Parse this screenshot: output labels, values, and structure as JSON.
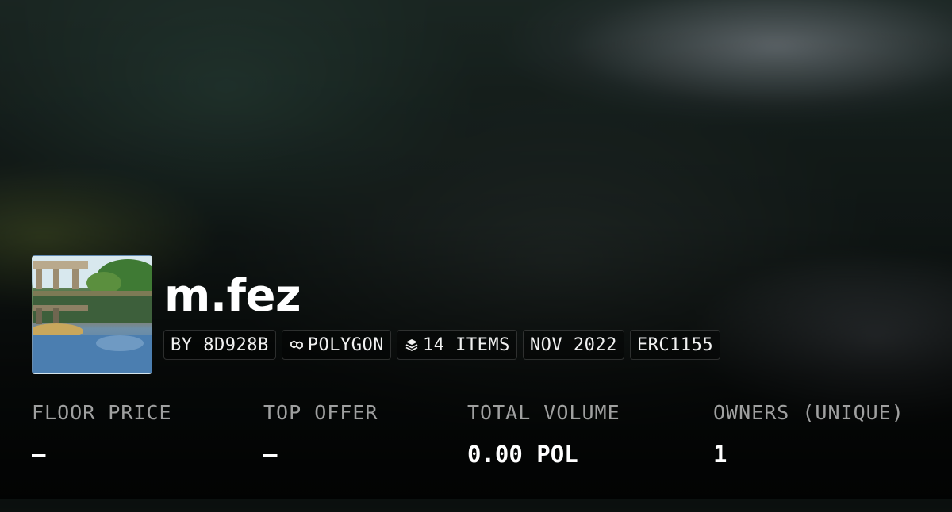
{
  "collection": {
    "title": "m.fez",
    "tags": [
      {
        "icon": "",
        "label": "BY 8D928B"
      },
      {
        "icon": "polygon-chain-icon",
        "label": "POLYGON"
      },
      {
        "icon": "layers-icon",
        "label": "14 ITEMS"
      },
      {
        "icon": "",
        "label": "NOV 2022"
      },
      {
        "icon": "",
        "label": "ERC1155"
      }
    ]
  },
  "stats": [
    {
      "label": "FLOOR PRICE",
      "value": "—"
    },
    {
      "label": "TOP OFFER",
      "value": "—"
    },
    {
      "label": "TOTAL VOLUME",
      "value": "0.00 POL"
    },
    {
      "label": "OWNERS (UNIQUE)",
      "value": "1"
    }
  ]
}
